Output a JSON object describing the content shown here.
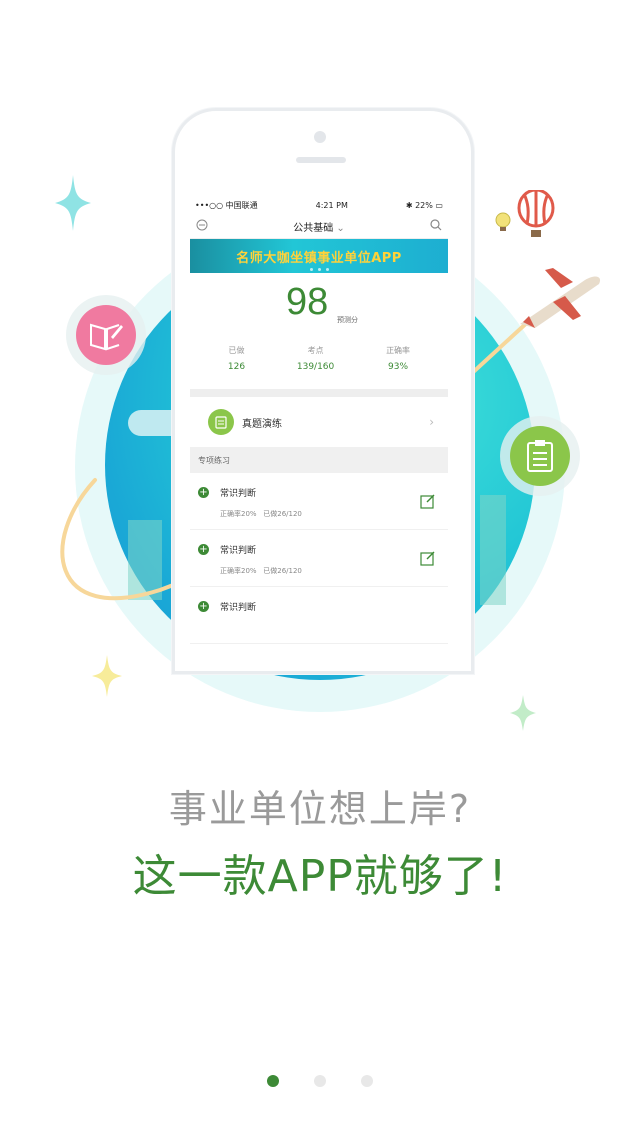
{
  "colors": {
    "accent": "#3d8a36",
    "light_green": "#8bc64a",
    "globe": "#22c6d6",
    "pink": "#f07aa0",
    "banner_text": "#ffd23a"
  },
  "statusbar": {
    "carrier": "•••○○ 中国联通",
    "time": "4:21 PM",
    "battery": "22%"
  },
  "navbar": {
    "title": "公共基础",
    "left_icon": "message-icon",
    "right_icon": "search-icon"
  },
  "banner": {
    "text": "名师大咖坐镇事业单位APP"
  },
  "score": {
    "value": "98",
    "unit": "预测分"
  },
  "stats": [
    {
      "label": "已做",
      "value": "126"
    },
    {
      "label": "考点",
      "value": "139/160"
    },
    {
      "label": "正确率",
      "value": "93%"
    }
  ],
  "zhenti": {
    "label": "真题演练"
  },
  "section": {
    "title": "专项练习"
  },
  "practice_items": [
    {
      "title": "常识判断",
      "accuracy": "正确率20%",
      "done": "已做26/120"
    },
    {
      "title": "常识判断",
      "accuracy": "正确率20%",
      "done": "已做26/120"
    },
    {
      "title": "常识判断",
      "accuracy": "",
      "done": ""
    }
  ],
  "headline": {
    "line1": "事业单位想上岸?",
    "line2": "这一款APP就够了!"
  },
  "pager": {
    "count": 3,
    "active_index": 0
  }
}
